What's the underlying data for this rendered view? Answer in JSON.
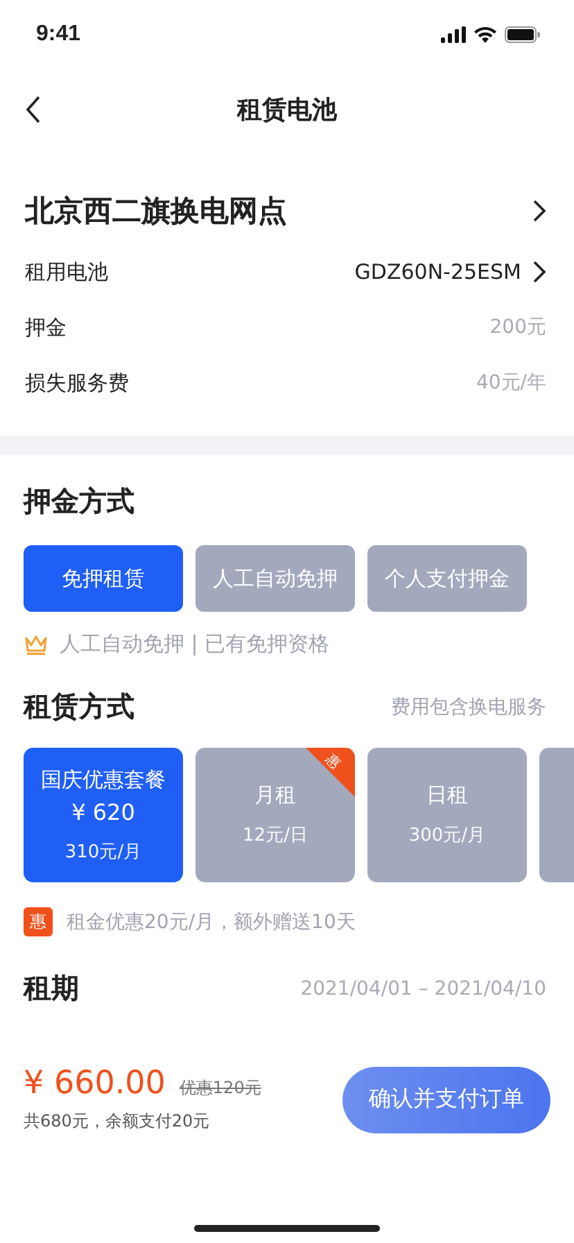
{
  "status_bar": {
    "time": "9:41"
  },
  "nav": {
    "title": "租赁电池"
  },
  "station": {
    "name": "北京西二旗换电网点",
    "rows": [
      {
        "label": "租用电池",
        "value": "GDZ60N-25ESM",
        "arrow": true
      },
      {
        "label": "押金",
        "value": "200元",
        "arrow": false
      },
      {
        "label": "损失服务费",
        "value": "40元/年",
        "arrow": false
      }
    ]
  },
  "deposit": {
    "title": "押金方式",
    "options": [
      {
        "label": "免押租赁",
        "selected": true
      },
      {
        "label": "人工自动免押",
        "selected": false
      },
      {
        "label": "个人支付押金",
        "selected": false
      }
    ],
    "note": "人工自动免押 | 已有免押资格"
  },
  "rental": {
    "title": "租赁方式",
    "hint": "费用包含换电服务",
    "plans": [
      {
        "name": "国庆优惠套餐",
        "price": "¥ 620",
        "unit": "310元/月",
        "selected": true
      },
      {
        "name": "月租",
        "unit": "12元/日",
        "selected": false,
        "badge": "惠"
      },
      {
        "name": "日租",
        "unit": "300元/月",
        "selected": false
      }
    ],
    "promo_tag": "惠",
    "promo": "租金优惠20元/月，额外赠送10天"
  },
  "period": {
    "title": "租期",
    "range": "2021/04/01 – 2021/04/10"
  },
  "footer": {
    "total": "¥ 660.00",
    "discount": "优惠120元",
    "detail": "共680元，余额支付20元",
    "button": "确认并支付订单"
  }
}
